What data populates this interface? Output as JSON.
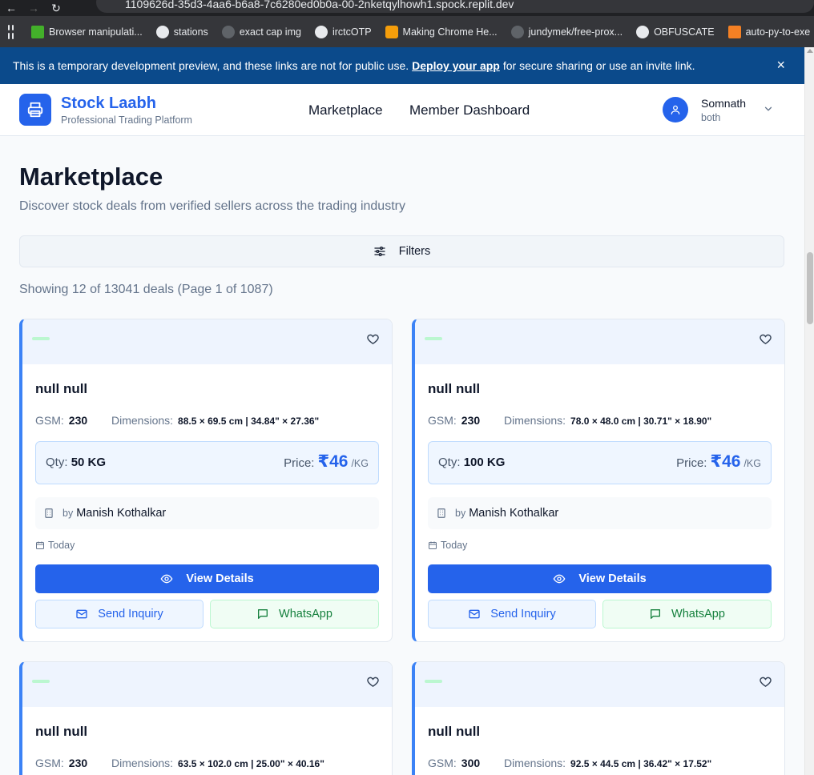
{
  "browser": {
    "url": "1109626d-35d3-4aa6-b6a8-7c6280ed0b0a-00-2nketqylhowh1.spock.replit.dev",
    "bookmarks": [
      {
        "label": "Browser manipulati...",
        "icon": "selenium-icon"
      },
      {
        "label": "stations",
        "icon": "github-icon"
      },
      {
        "label": "exact cap img",
        "icon": "github-icon"
      },
      {
        "label": "irctcOTP",
        "icon": "github-icon"
      },
      {
        "label": "Making Chrome He...",
        "icon": "cube-icon"
      },
      {
        "label": "jundymek/free-prox...",
        "icon": "github-icon"
      },
      {
        "label": "OBFUSCATE",
        "icon": "globe-icon"
      },
      {
        "label": "auto-py-to-exe",
        "icon": "stackoverflow-icon"
      }
    ]
  },
  "devbar": {
    "text_before": "This is a temporary development preview, and these links are not for public use.",
    "link": "Deploy your app",
    "text_after": "for secure sharing or use an invite link.",
    "close": "×"
  },
  "header": {
    "brand": "Stock Laabh",
    "tagline": "Professional Trading Platform",
    "nav": [
      "Marketplace",
      "Member Dashboard"
    ],
    "user_name": "Somnath",
    "user_role": "both"
  },
  "main": {
    "title": "Marketplace",
    "subtitle": "Discover stock deals from verified sellers across the trading industry",
    "filters_label": "Filters",
    "showing": "Showing 12 of 13041 deals (Page 1 of 1087)"
  },
  "labels": {
    "gsm": "GSM:",
    "dimensions": "Dimensions:",
    "qty": "Qty:",
    "price": "Price:",
    "by": "by",
    "view": "View Details",
    "inquiry": "Send Inquiry",
    "whatsapp": "WhatsApp"
  },
  "colors": {
    "primary": "#2563eb",
    "banner": "#0b4a8b",
    "whatsapp": "#15803d"
  },
  "cards": [
    {
      "title": "null null",
      "gsm": "230",
      "dimensions": "88.5 × 69.5 cm | 34.84\" × 27.36\"",
      "qty": "50 KG",
      "price": "₹46",
      "unit": "/KG",
      "seller": "Manish Kothalkar",
      "date": "Today"
    },
    {
      "title": "null null",
      "gsm": "230",
      "dimensions": "78.0 × 48.0 cm | 30.71\" × 18.90\"",
      "qty": "100 KG",
      "price": "₹46",
      "unit": "/KG",
      "seller": "Manish Kothalkar",
      "date": "Today"
    },
    {
      "title": "null null",
      "gsm": "230",
      "dimensions": "63.5 × 102.0 cm | 25.00\" × 40.16\""
    },
    {
      "title": "null null",
      "gsm": "300",
      "dimensions": "92.5 × 44.5 cm | 36.42\" × 17.52\""
    }
  ]
}
